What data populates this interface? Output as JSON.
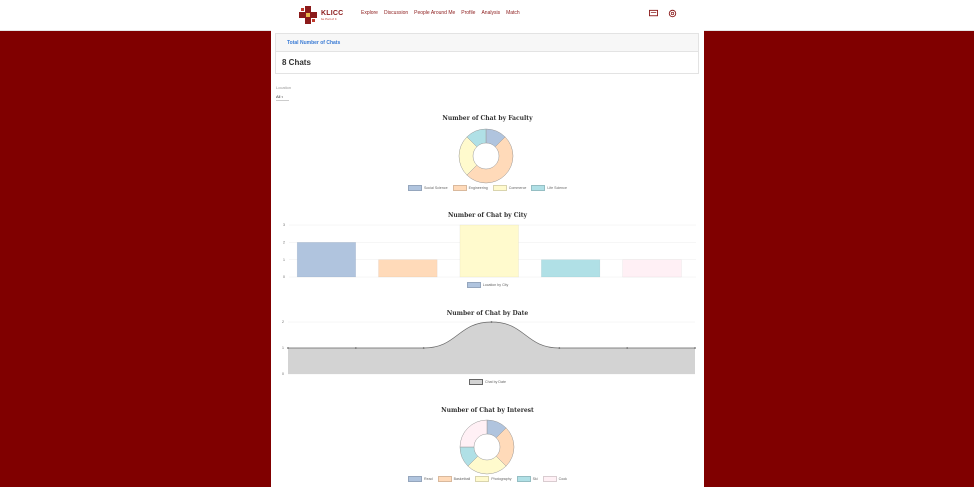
{
  "app": {
    "logo_title": "KLICC",
    "logo_sub": "be Part of It"
  },
  "nav": [
    "Explore",
    "Discussion",
    "People Around Me",
    "Profile",
    "Analysis",
    "Match"
  ],
  "icons": {
    "top_left": "message-icon",
    "top_right": "settings-icon"
  },
  "summary": {
    "header": "Total Number of Chats",
    "value": "8 Chats"
  },
  "filter": {
    "label": "Location",
    "value": "All"
  },
  "colors": {
    "blue": "#b0c4de",
    "orange": "#ffdab9",
    "yellow": "#fffacd",
    "teal": "#b0e0e6",
    "pink": "#fff0f5",
    "gray": "#d3d3d3"
  },
  "chart_data": [
    {
      "type": "pie",
      "variant": "doughnut",
      "title": "Number of Chat by Faculty",
      "labels": [
        "Social Science",
        "Engineering",
        "Commerce",
        "Life Science"
      ],
      "values": [
        1,
        4,
        2,
        1
      ]
    },
    {
      "type": "bar",
      "title": "Number of Chat by City",
      "categories": [
        "",
        "",
        "",
        "",
        ""
      ],
      "series": [
        {
          "name": "Location by City",
          "values": [
            2,
            1,
            3,
            1,
            1
          ]
        }
      ],
      "ylim": [
        0,
        3
      ],
      "yticks": [
        "0",
        "1",
        "2",
        "3"
      ]
    },
    {
      "type": "area",
      "title": "Number of Chat by Date",
      "x": [
        "",
        "",
        "",
        "",
        "",
        "",
        ""
      ],
      "series": [
        {
          "name": "Chat by Date",
          "values": [
            1,
            1,
            1,
            2,
            1,
            1,
            1
          ]
        }
      ],
      "ylim": [
        0,
        2
      ],
      "yticks": [
        "0",
        "1",
        "2"
      ]
    },
    {
      "type": "pie",
      "variant": "doughnut",
      "title": "Number of Chat by Interest",
      "labels": [
        "Read",
        "Basketball",
        "Photography",
        "Ski",
        "Cook"
      ],
      "values": [
        1,
        2,
        2,
        1,
        2
      ]
    }
  ]
}
